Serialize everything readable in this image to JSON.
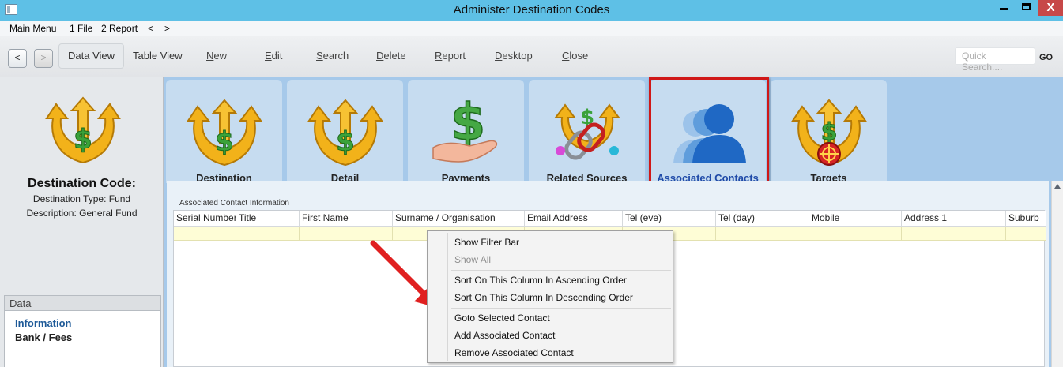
{
  "window": {
    "title": "Administer Destination Codes",
    "close_glyph": "X"
  },
  "menubar": {
    "items": [
      "Main Menu",
      "1 File",
      "2 Report",
      "<",
      ">"
    ]
  },
  "toolbar": {
    "back": "<",
    "forward": ">",
    "data_view": "Data View",
    "table_view": "Table View",
    "new": {
      "hot": "N",
      "rest": "ew"
    },
    "edit": {
      "hot": "E",
      "rest": "dit"
    },
    "search": {
      "hot": "S",
      "rest": "earch"
    },
    "delete": {
      "hot": "D",
      "rest": "elete"
    },
    "report": {
      "hot": "R",
      "rest": "eport"
    },
    "desktop": {
      "hot": "D",
      "rest": "esktop"
    },
    "close": {
      "hot": "C",
      "rest": "lose"
    },
    "search_placeholder": "Quick Search....",
    "go": "GO"
  },
  "left_panel": {
    "title": "Destination Code:",
    "type_line": "Destination Type: Fund",
    "description_line": "Description: General Fund",
    "data_header": "Data",
    "items": [
      "Information",
      "Bank / Fees"
    ]
  },
  "tabs": [
    {
      "label": "Destination",
      "icon": "money-arrows-icon"
    },
    {
      "label": "Detail",
      "icon": "money-arrows-icon"
    },
    {
      "label": "Payments",
      "icon": "hand-dollar-icon"
    },
    {
      "label": "Related Sources",
      "icon": "chain-link-icon"
    },
    {
      "label": "Associated Contacts",
      "icon": "contacts-people-icon"
    },
    {
      "label": "Targets",
      "icon": "money-target-icon"
    }
  ],
  "active_tab": "Associated Contacts",
  "content": {
    "section_label": "Associated Contact Information",
    "columns": [
      "Serial Number",
      "Title",
      "First Name",
      "Surname / Organisation",
      "Email Address",
      "Tel (eve)",
      "Tel (day)",
      "Mobile",
      "Address 1",
      "Suburb"
    ]
  },
  "context_menu": {
    "items": [
      {
        "label": "Show Filter Bar",
        "enabled": true
      },
      {
        "label": "Show All",
        "enabled": false
      },
      {
        "label": "Sort On This Column In Ascending Order",
        "enabled": true
      },
      {
        "label": "Sort On This Column In Descending Order",
        "enabled": true
      },
      {
        "label": "Goto Selected Contact",
        "enabled": true
      },
      {
        "label": "Add Associated Contact",
        "enabled": true
      },
      {
        "label": "Remove Associated Contact",
        "enabled": true
      }
    ]
  },
  "colors": {
    "titlebar": "#5ec0e6",
    "highlight": "#d01818",
    "active_tab_label": "#1f4aa8",
    "filter_row": "#fefdd6",
    "main_background": "#a6c9ea"
  }
}
